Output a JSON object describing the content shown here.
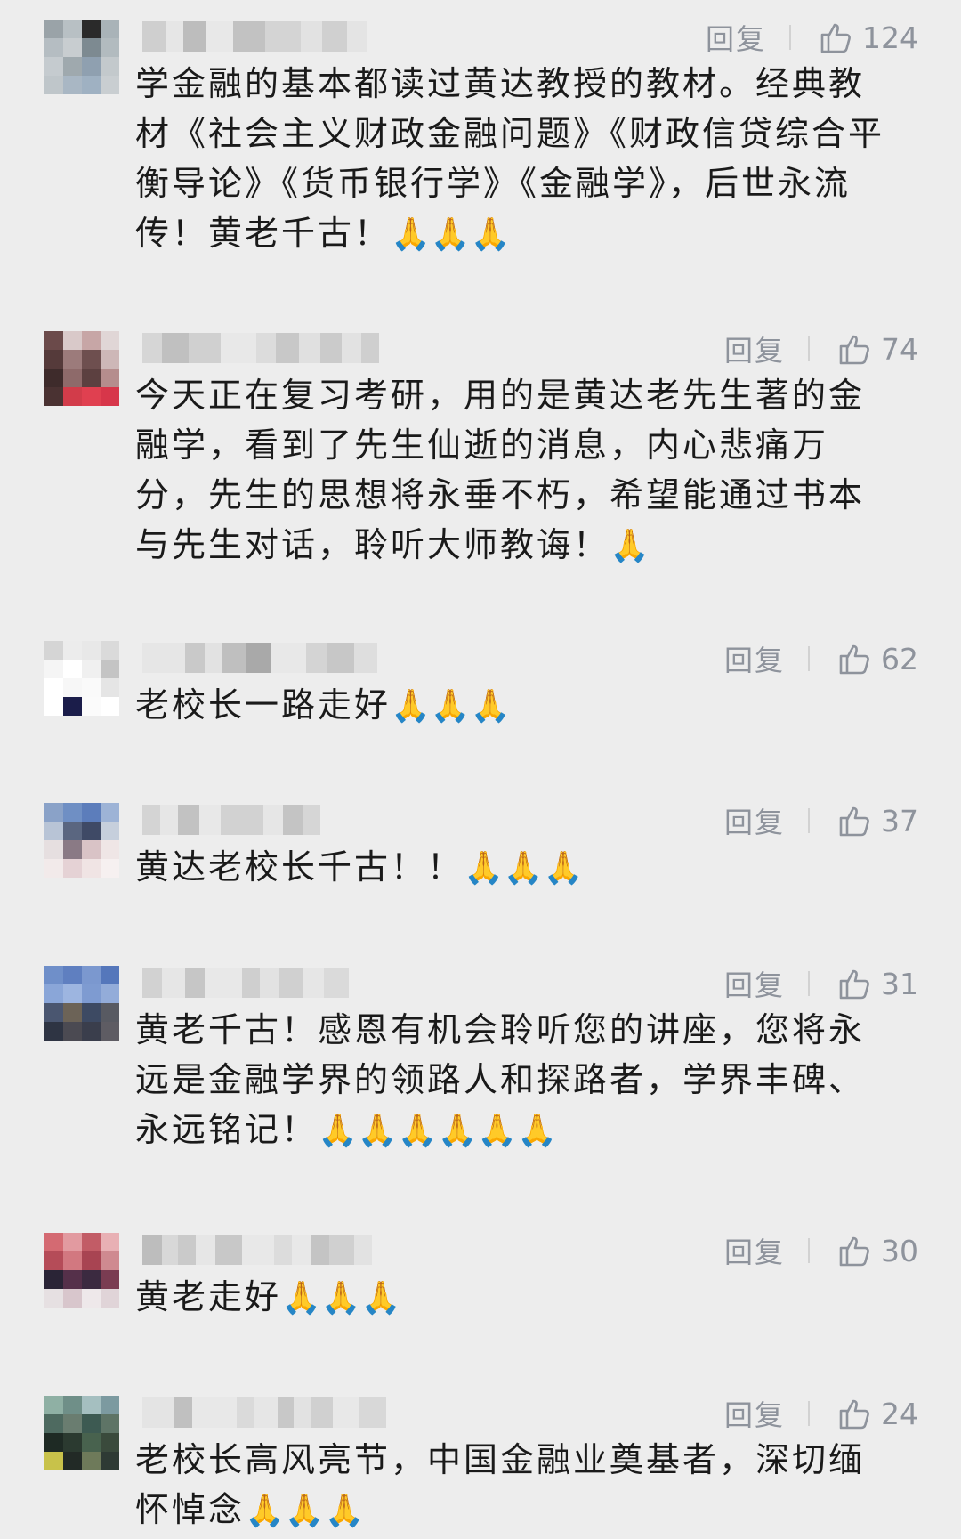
{
  "comments": [
    {
      "reply_label": "回复",
      "likes": "124",
      "text": "学金融的基本都读过黄达教授的教材。经典教材《社会主义财政金融问题》《财政信贷综合平衡导论》《货币银行学》《金融学》，后世永流传！黄老千古！",
      "emoji": "🙏🙏🙏"
    },
    {
      "reply_label": "回复",
      "likes": "74",
      "text": "今天正在复习考研，用的是黄达老先生著的金融学，看到了先生仙逝的消息，内心悲痛万分，先生的思想将永垂不朽，希望能通过书本与先生对话，聆听大师教诲！",
      "emoji": "🙏"
    },
    {
      "reply_label": "回复",
      "likes": "62",
      "text": "老校长一路走好",
      "emoji": "🙏🙏🙏"
    },
    {
      "reply_label": "回复",
      "likes": "37",
      "text": "黄达老校长千古！！",
      "emoji": "🙏🙏🙏"
    },
    {
      "reply_label": "回复",
      "likes": "31",
      "text": "黄老千古！感恩有机会聆听您的讲座，您将永远是金融学界的领路人和探路者，学界丰碑、永远铭记！",
      "emoji": "🙏🙏🙏🙏🙏🙏"
    },
    {
      "reply_label": "回复",
      "likes": "30",
      "text": "黄老走好",
      "emoji": "🙏🙏🙏"
    },
    {
      "reply_label": "回复",
      "likes": "24",
      "text": "老校长高风亮节，中国金融业奠基者，深切缅怀悼念",
      "emoji": "🙏🙏🙏"
    }
  ]
}
